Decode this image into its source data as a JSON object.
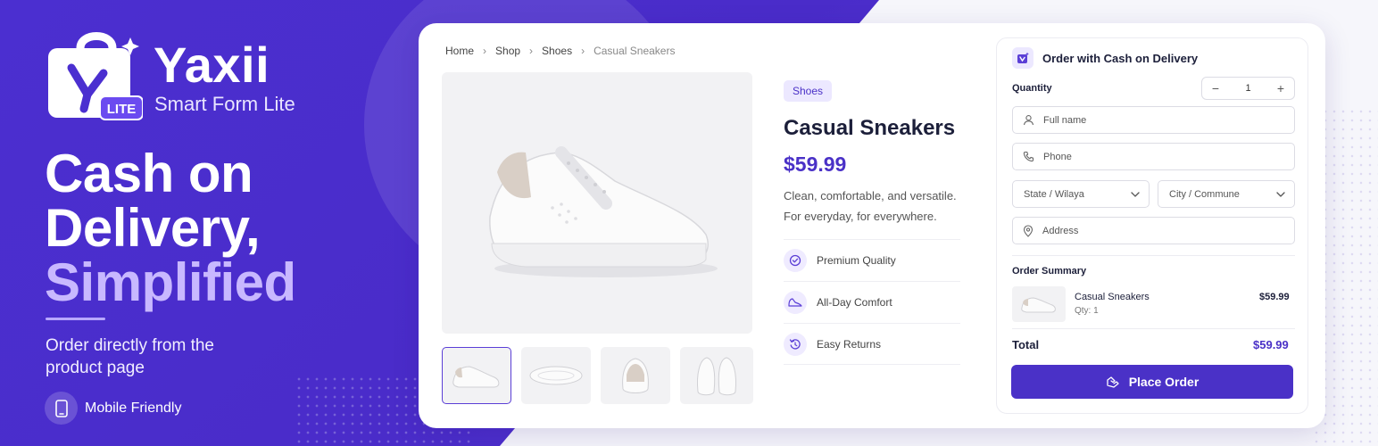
{
  "brand": {
    "name": "Yaxii",
    "subtitle": "Smart Form Lite",
    "badge": "LITE"
  },
  "hero": {
    "line1": "Cash on",
    "line2": "Delivery,",
    "line3": "Simplified",
    "subtext": "Order directly from the product page",
    "feature_label": "Mobile Friendly"
  },
  "breadcrumb": {
    "items": [
      "Home",
      "Shop",
      "Shoes"
    ],
    "current": "Casual Sneakers"
  },
  "product": {
    "category": "Shoes",
    "title": "Casual Sneakers",
    "price": "$59.99",
    "description": "Clean, comfortable, and versatile. For everyday, for everywhere.",
    "features": [
      {
        "label": "Premium Quality",
        "icon": "badge-check-icon"
      },
      {
        "label": "All-Day Comfort",
        "icon": "shoe-icon"
      },
      {
        "label": "Easy Returns",
        "icon": "return-icon"
      }
    ]
  },
  "order": {
    "title": "Order with Cash on Delivery",
    "quantity_label": "Quantity",
    "quantity": "1",
    "fullname_placeholder": "Full name",
    "phone_placeholder": "Phone",
    "state_placeholder": "State / Wilaya",
    "city_placeholder": "City / Commune",
    "address_placeholder": "Address",
    "summary_title": "Order Summary",
    "summary_item_name": "Casual Sneakers",
    "summary_item_qty": "Qty: 1",
    "summary_item_price": "$59.99",
    "total_label": "Total",
    "total_value": "$59.99",
    "button_label": "Place Order"
  },
  "colors": {
    "brand_purple": "#4a31c7",
    "accent_light": "#c8b8ff"
  }
}
